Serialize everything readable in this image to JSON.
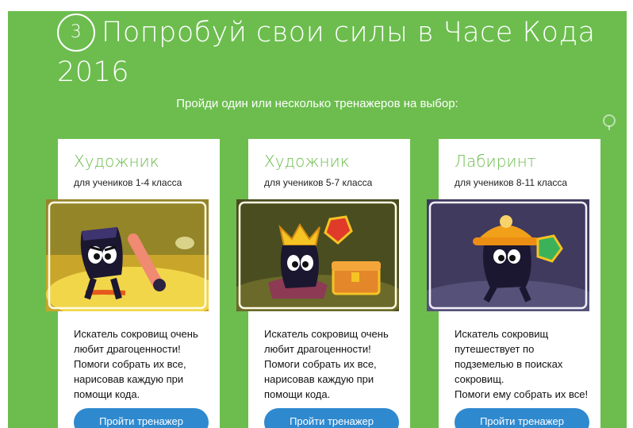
{
  "heading": {
    "step_number": "3",
    "title_line1": "Попробуй свои силы в Часе Кода",
    "title_line2": "2016"
  },
  "subtitle": "Пройди один или несколько тренажеров на выбор:",
  "cards": [
    {
      "title": "Художник",
      "grade": "для учеников 1-4 класса",
      "description_lines": [
        "Искатель сокровищ очень",
        "любит драгоценности!",
        "Помоги собрать их все,",
        "нарисовав каждую при",
        "помощи кода."
      ],
      "button_label": "Пройти тренажер"
    },
    {
      "title": "Художник",
      "grade": "для учеников 5-7 класса",
      "description_lines": [
        "Искатель сокровищ очень",
        "любит драгоценности!",
        "Помоги собрать их все,",
        "нарисовав каждую при",
        "помощи кода."
      ],
      "button_label": "Пройти тренажер"
    },
    {
      "title": "Лабиринт",
      "grade": "для учеников 8-11 класса",
      "description_lines": [
        "Искатель сокровищ",
        "путешествует по",
        "подземелью в поисках",
        "сокровищ.",
        "Помоги ему собрать их все!"
      ],
      "button_label": "Пройти тренажер"
    }
  ],
  "colors": {
    "background": "#6cbd4e",
    "title_green": "#6cbd4e",
    "button_blue": "#2f89cf"
  },
  "icons": {
    "step_badge": "circle-number-3",
    "pin": "location-pin-icon"
  }
}
